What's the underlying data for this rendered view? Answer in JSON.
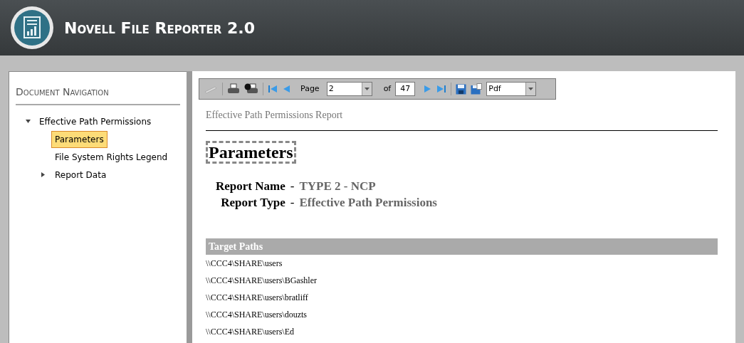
{
  "app": {
    "title": "Novell File Reporter 2.0"
  },
  "navigation": {
    "title": "Document Navigation",
    "items": [
      {
        "label": "Effective Path Permissions",
        "selected": false,
        "expanded": true,
        "children": [
          {
            "label": "Parameters",
            "selected": true
          },
          {
            "label": "File System Rights Legend",
            "selected": false
          },
          {
            "label": "Report Data",
            "selected": false,
            "expanded": false
          }
        ]
      }
    ]
  },
  "toolbar": {
    "page_label": "Page",
    "page": "2",
    "of_label": "of",
    "total_pages": "47",
    "format": "Pdf"
  },
  "report": {
    "title": "Effective Path Permissions Report",
    "heading": "Parameters",
    "parameters": [
      {
        "label": "Report Name",
        "separator": "-",
        "value": "TYPE 2 - NCP"
      },
      {
        "label": "Report Type",
        "separator": "-",
        "value": "Effective Path Permissions"
      }
    ],
    "section": {
      "title": "Target Paths",
      "rows": [
        "\\\\CCC4\\SHARE\\users",
        "\\\\CCC4\\SHARE\\users\\BGashler",
        "\\\\CCC4\\SHARE\\users\\bratliff",
        "\\\\CCC4\\SHARE\\users\\douzts",
        "\\\\CCC4\\SHARE\\users\\Ed"
      ]
    }
  }
}
